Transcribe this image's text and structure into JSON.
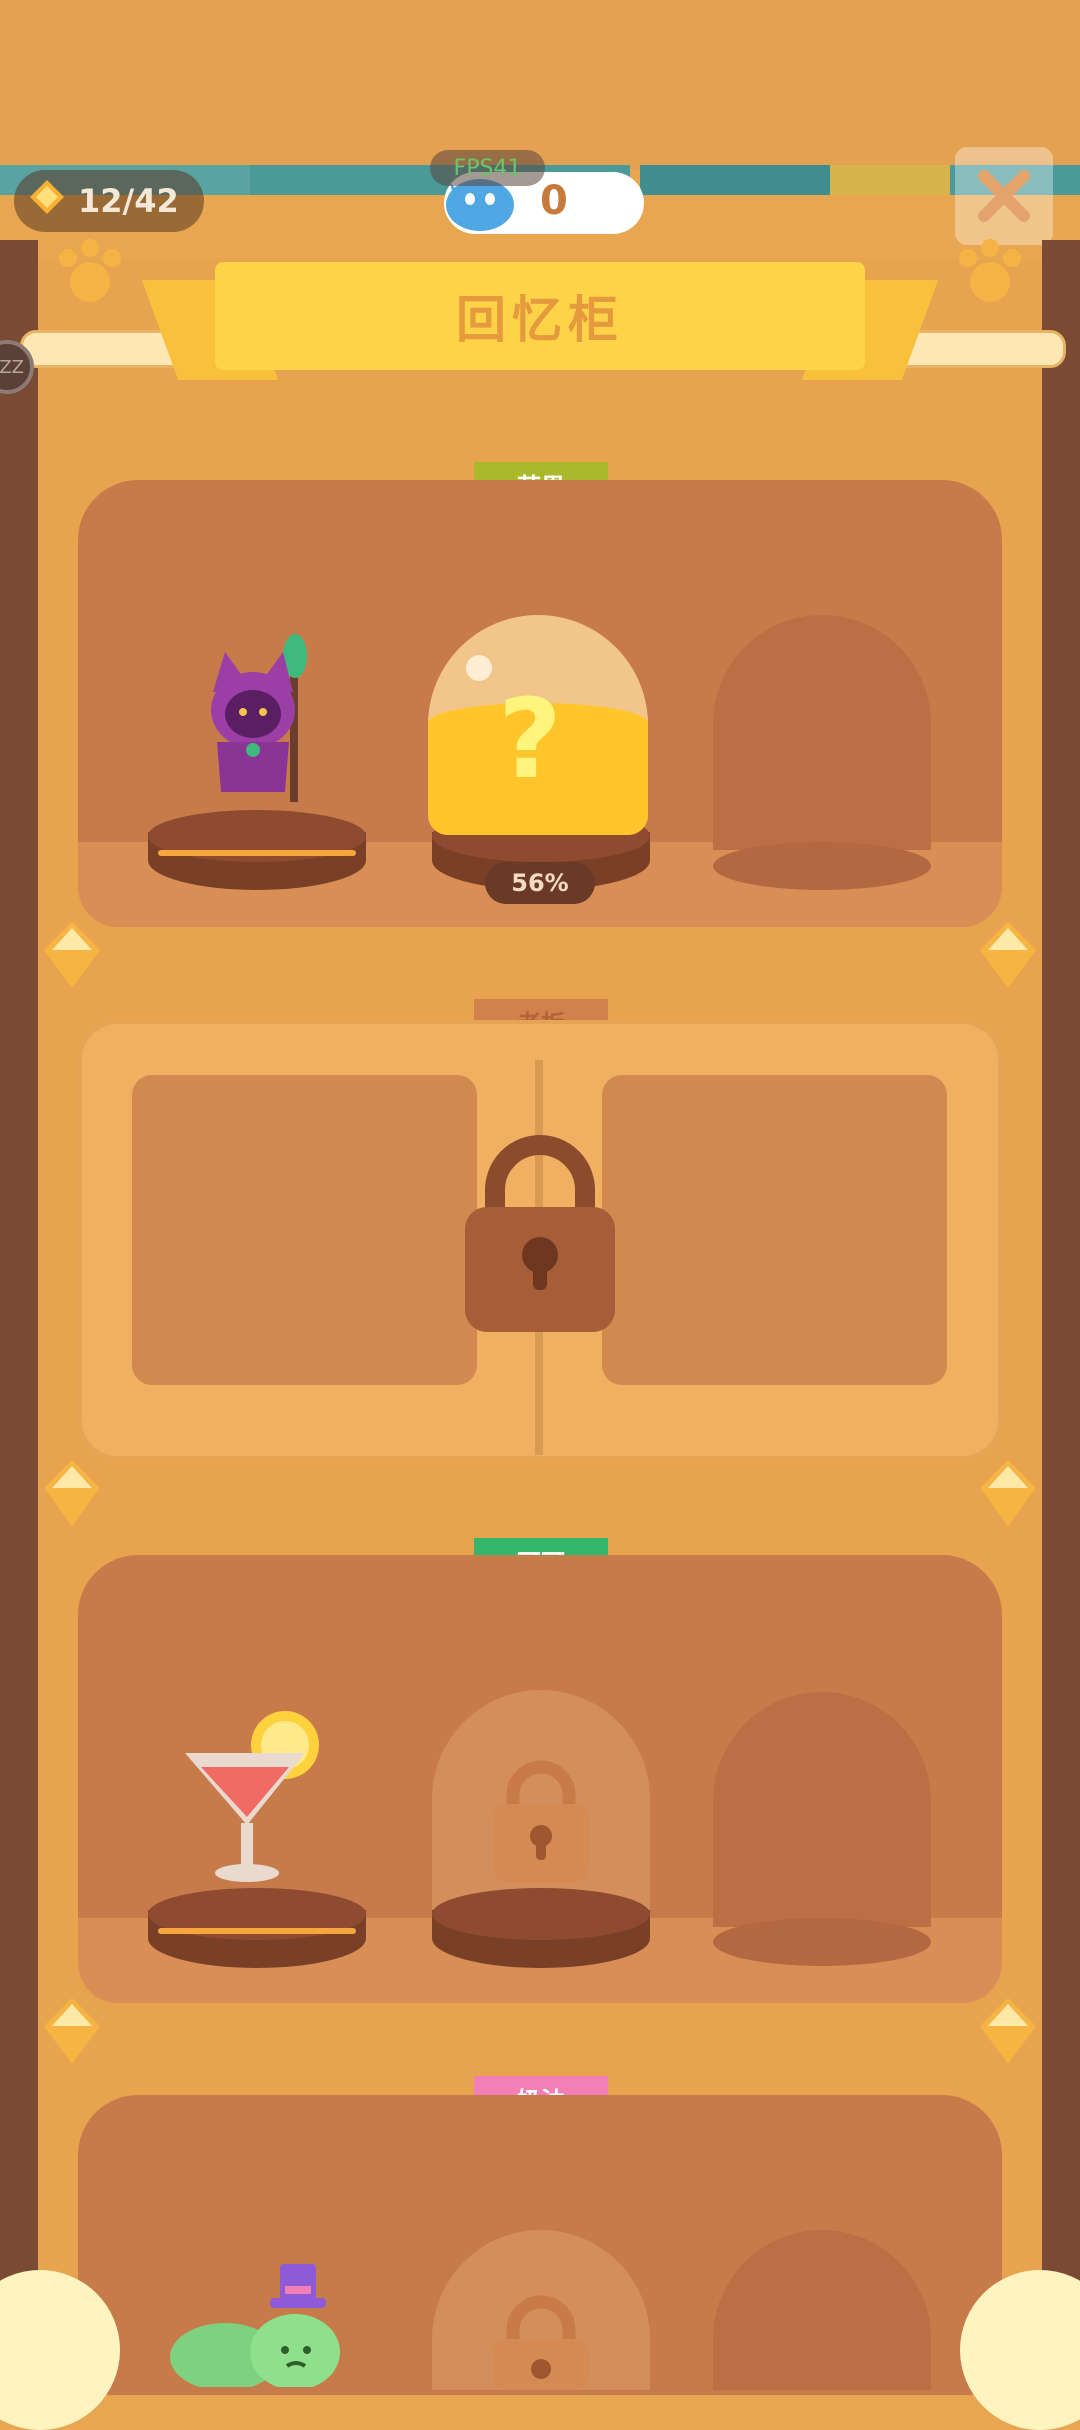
{
  "hud": {
    "collected": "12/42",
    "fps_label": "FPS41",
    "currency_value": "0",
    "close_icon": "close-icon"
  },
  "header": {
    "title": "回忆柜",
    "side_badge": "ZZ"
  },
  "sections": [
    {
      "tag": "芒果",
      "tag_color": "#A9B92B",
      "progress": "56%",
      "locked": false
    },
    {
      "tag": "老板",
      "tag_color": "#D0814C",
      "locked": true
    },
    {
      "tag": "可可",
      "tag_color": "#33B56A",
      "locked": false
    },
    {
      "tag": "奶油",
      "tag_color": "#F27FB6",
      "locked": false
    }
  ],
  "colors": {
    "background": "#E7A64F",
    "banner": "#FFD348",
    "shelf": "#C77B4B"
  }
}
